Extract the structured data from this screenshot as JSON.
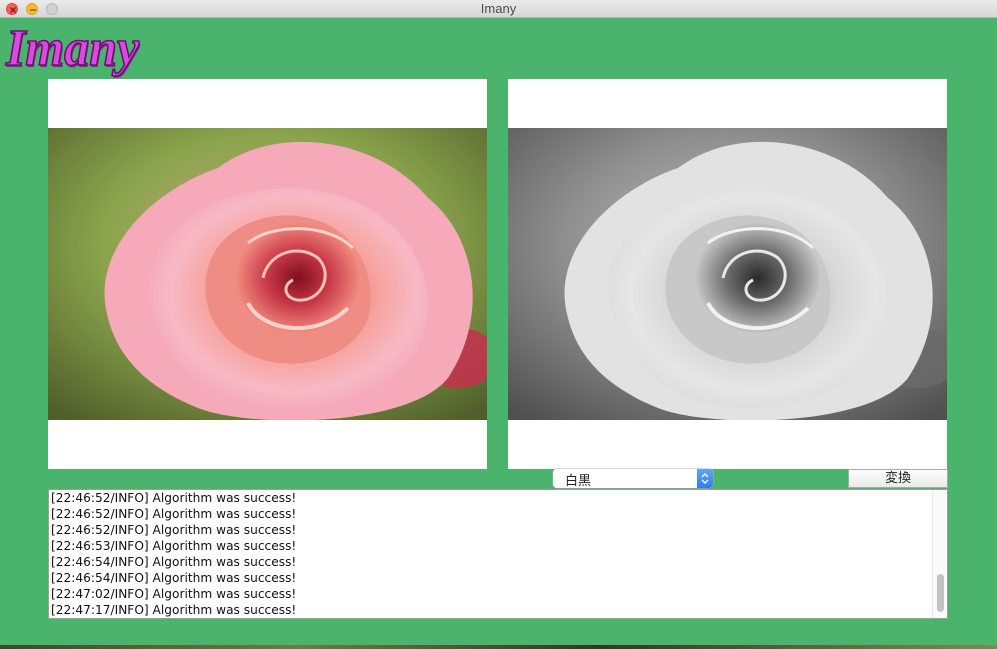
{
  "window": {
    "title": "Imany"
  },
  "logo": {
    "text": "Imany"
  },
  "images": {
    "original": {
      "icon": "rose-color-photo"
    },
    "converted": {
      "icon": "rose-grayscale-photo"
    }
  },
  "controls": {
    "mode_selected": "白黒",
    "convert_label": "変換"
  },
  "log": {
    "lines": [
      "[22:46:52/INFO] Algorithm was success!",
      "[22:46:52/INFO] Algorithm was success!",
      "[22:46:52/INFO] Algorithm was success!",
      "[22:46:53/INFO] Algorithm was success!",
      "[22:46:54/INFO] Algorithm was success!",
      "[22:46:54/INFO] Algorithm was success!",
      "[22:47:02/INFO] Algorithm was success!",
      "[22:47:17/INFO] Algorithm was success!"
    ]
  },
  "colors": {
    "background": "#4ab46c",
    "logo": "#d94bdc",
    "select_accent": "#2f7ef0"
  }
}
